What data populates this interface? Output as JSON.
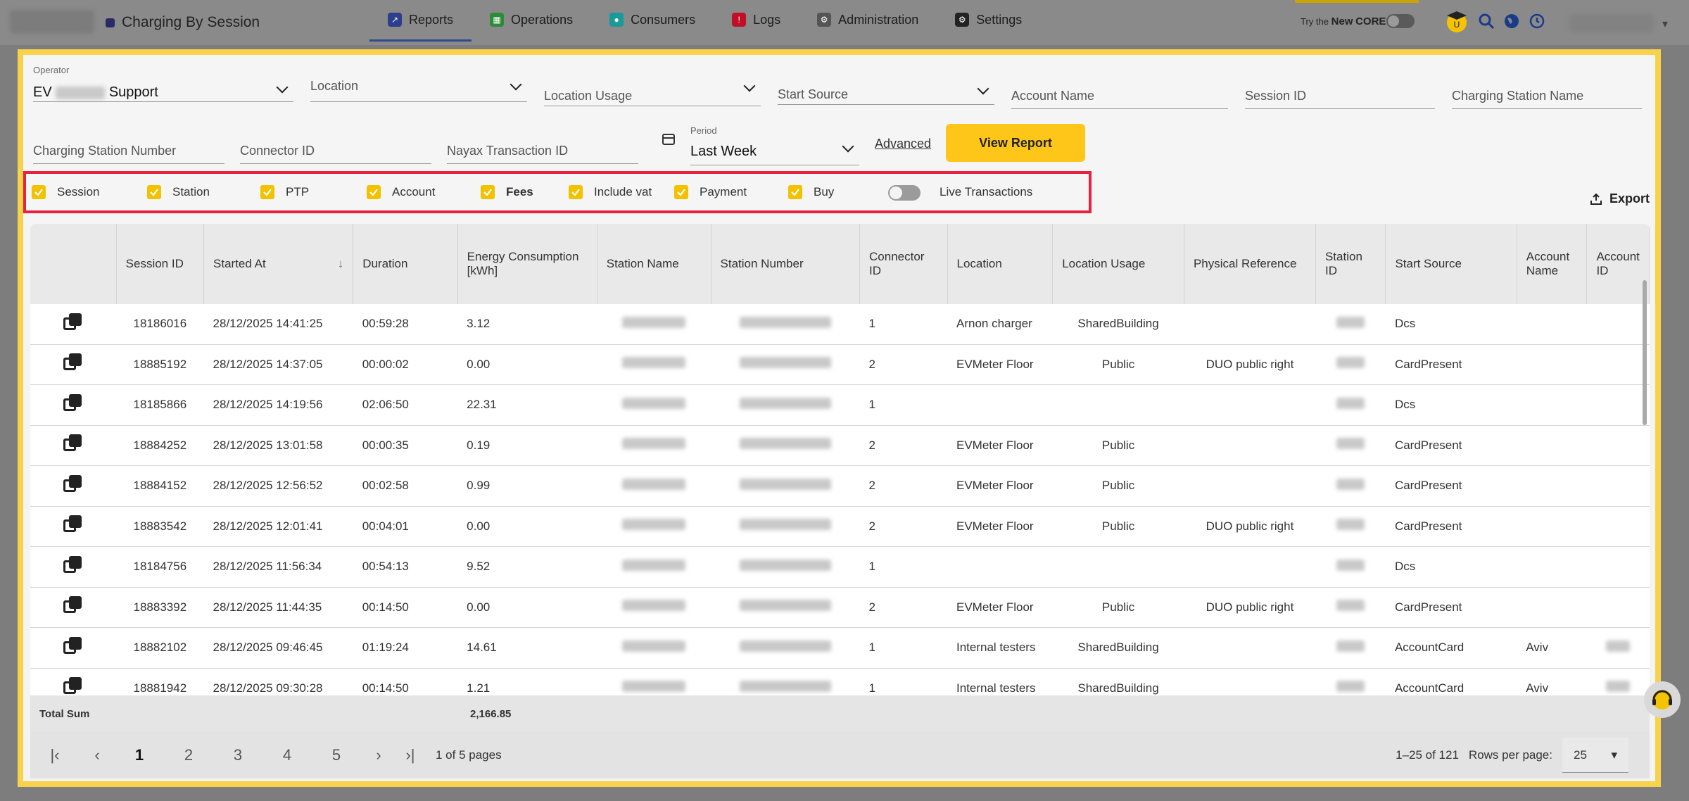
{
  "header": {
    "page_title": "Charging By Session",
    "nav": [
      {
        "label": "Reports",
        "color": "#2c3e8c"
      },
      {
        "label": "Operations",
        "color": "#2e8b3a"
      },
      {
        "label": "Consumers",
        "color": "#199999"
      },
      {
        "label": "Logs",
        "color": "#c01028"
      },
      {
        "label": "Administration",
        "color": "#555555"
      },
      {
        "label": "Settings",
        "color": "#222222"
      }
    ],
    "try_prefix": "Try the",
    "try_new": "New",
    "try_core": "CORE"
  },
  "filters": {
    "operator_label": "Operator",
    "operator_value_prefix": "EV",
    "operator_value_suffix": "Support",
    "location": "Location",
    "location_usage": "Location Usage",
    "start_source": "Start Source",
    "account_name": "Account Name",
    "session_id": "Session ID",
    "charging_station_name": "Charging Station Name",
    "charging_station_number": "Charging Station Number",
    "connector_id": "Connector ID",
    "nayax_transaction_id": "Nayax Transaction ID",
    "period_label": "Period",
    "period_value": "Last Week",
    "advanced": "Advanced",
    "view_report": "View Report"
  },
  "checkboxes": [
    {
      "label": "Session",
      "checked": true
    },
    {
      "label": "Station",
      "checked": true
    },
    {
      "label": "PTP",
      "checked": true
    },
    {
      "label": "Account",
      "checked": true
    },
    {
      "label": "Fees",
      "checked": true
    },
    {
      "label": "Include vat",
      "checked": true
    },
    {
      "label": "Payment",
      "checked": true
    },
    {
      "label": "Buy",
      "checked": true
    }
  ],
  "live_transactions": {
    "label": "Live Transactions",
    "on": false
  },
  "export_label": "Export",
  "table": {
    "columns": [
      "",
      "Session ID",
      "Started At",
      "Duration",
      "Energy Consumption [kWh]",
      "Station Name",
      "Station Number",
      "Connector ID",
      "Location",
      "Location Usage",
      "Physical Reference",
      "Station ID",
      "Start Source",
      "Account Name",
      "Account ID"
    ],
    "rows": [
      [
        "18186016",
        "28/12/2025 14:41:25",
        "00:59:28",
        "3.12",
        "1",
        "Arnon charger",
        "SharedBuilding",
        "",
        "Dcs",
        ""
      ],
      [
        "18885192",
        "28/12/2025 14:37:05",
        "00:00:02",
        "0.00",
        "2",
        "EVMeter Floor",
        "Public",
        "DUO public right",
        "CardPresent",
        ""
      ],
      [
        "18185866",
        "28/12/2025 14:19:56",
        "02:06:50",
        "22.31",
        "1",
        "",
        "",
        "",
        "Dcs",
        ""
      ],
      [
        "18884252",
        "28/12/2025 13:01:58",
        "00:00:35",
        "0.19",
        "2",
        "EVMeter Floor",
        "Public",
        "",
        "CardPresent",
        ""
      ],
      [
        "18884152",
        "28/12/2025 12:56:52",
        "00:02:58",
        "0.99",
        "2",
        "EVMeter Floor",
        "Public",
        "",
        "CardPresent",
        ""
      ],
      [
        "18883542",
        "28/12/2025 12:01:41",
        "00:04:01",
        "0.00",
        "2",
        "EVMeter Floor",
        "Public",
        "DUO public right",
        "CardPresent",
        ""
      ],
      [
        "18184756",
        "28/12/2025 11:56:34",
        "00:54:13",
        "9.52",
        "1",
        "",
        "",
        "",
        "Dcs",
        ""
      ],
      [
        "18883392",
        "28/12/2025 11:44:35",
        "00:14:50",
        "0.00",
        "2",
        "EVMeter Floor",
        "Public",
        "DUO public right",
        "CardPresent",
        ""
      ],
      [
        "18882102",
        "28/12/2025 09:46:45",
        "01:19:24",
        "14.61",
        "1",
        "Internal testers",
        "SharedBuilding",
        "",
        "AccountCard",
        "Aviv"
      ],
      [
        "18881942",
        "28/12/2025 09:30:28",
        "00:14:50",
        "1.21",
        "1",
        "Internal testers",
        "SharedBuilding",
        "",
        "AccountCard",
        "Aviv"
      ]
    ]
  },
  "total": {
    "label": "Total Sum",
    "energy": "2,166.85"
  },
  "pagination": {
    "pages": [
      "1",
      "2",
      "3",
      "4",
      "5"
    ],
    "current": "1",
    "info": "1 of 5 pages",
    "range": "1–25 of 121",
    "rows_per_page_label": "Rows per page:",
    "rows_per_page": "25"
  }
}
